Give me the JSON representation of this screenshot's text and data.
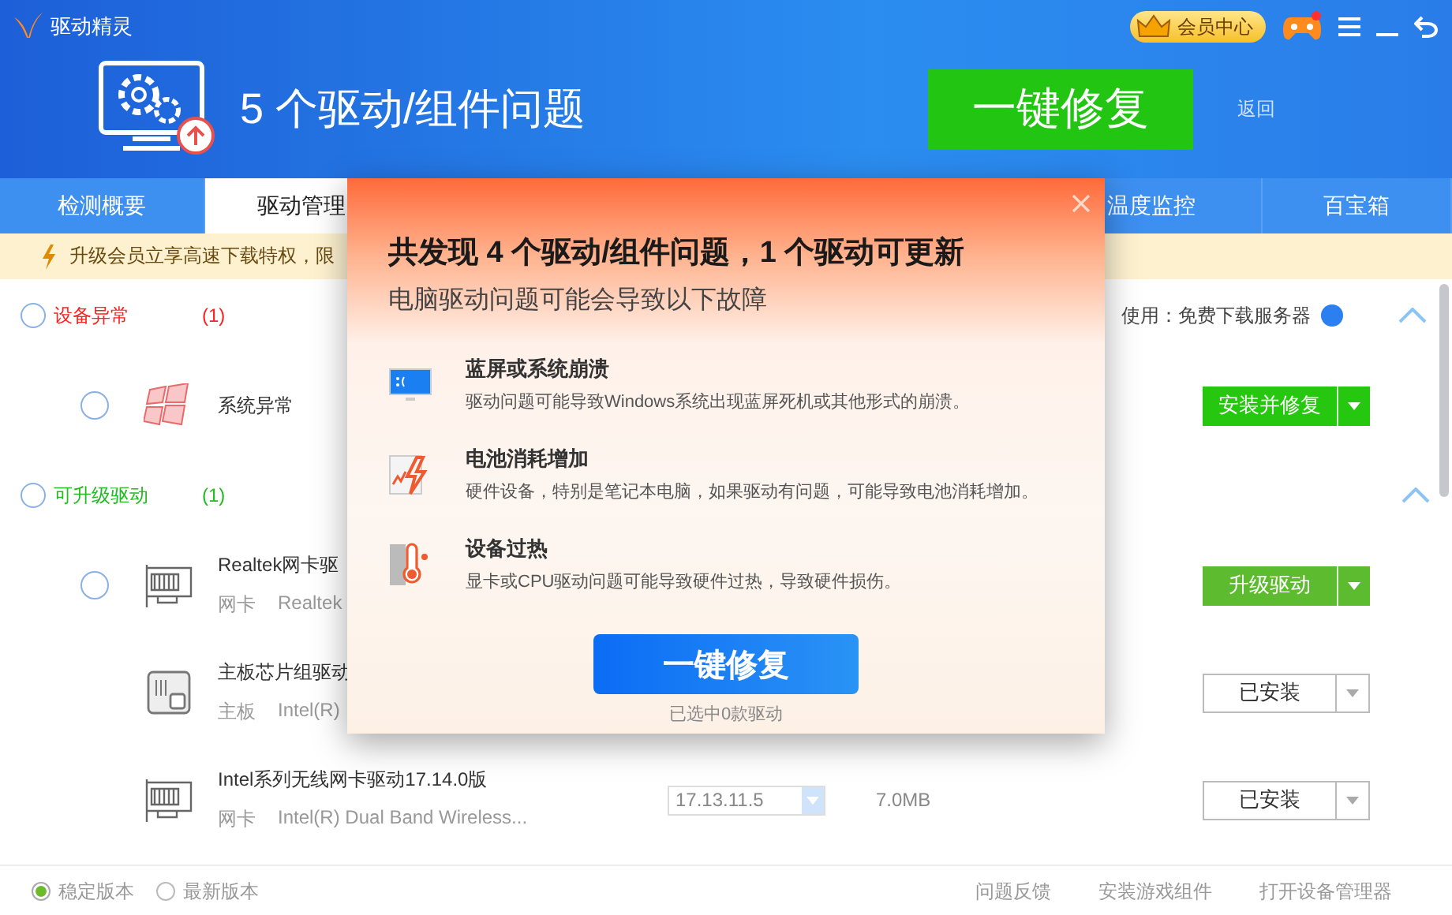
{
  "header": {
    "app_title": "驱动精灵",
    "vip_label": "会员中心",
    "issue_title": "5 个驱动/组件问题",
    "fix_button": "一键修复",
    "back_link": "返回"
  },
  "tabs": [
    {
      "label": "检测概要",
      "selected": false
    },
    {
      "label": "驱动管理",
      "selected": true
    },
    {
      "label": "温度监控",
      "selected": false
    },
    {
      "label": "百宝箱",
      "selected": false
    }
  ],
  "banner": {
    "text": "升级会员立享高速下载特权，限"
  },
  "server_note": "使用：免费下载服务器",
  "groups": [
    {
      "title": "设备异常",
      "count": "(1)",
      "color": "#ff2020",
      "checked": false,
      "expanded": true,
      "items": [
        {
          "kind": "system",
          "name": "系统异常",
          "checked": false,
          "action": {
            "label": "安装并修复",
            "kind": "primary"
          }
        }
      ]
    },
    {
      "title": "可升级驱动",
      "count": "(1)",
      "color": "#22bb22",
      "checked": false,
      "expanded": true,
      "items": [
        {
          "kind": "network",
          "name": "Realtek网卡驱",
          "category": "网卡",
          "detail": "Realtek",
          "checked": false,
          "action": {
            "label": "升级驱动",
            "kind": "upgrade"
          }
        },
        {
          "kind": "chipset",
          "name": "主板芯片组驱动",
          "category": "主板",
          "detail": "Intel(R)",
          "action": {
            "label": "已安装",
            "kind": "installed"
          }
        },
        {
          "kind": "network",
          "name": "Intel系列无线网卡驱动17.14.0版",
          "category": "网卡",
          "detail": "Intel(R) Dual Band Wireless...",
          "version": "17.13.11.5",
          "size": "7.0MB",
          "action": {
            "label": "已安装",
            "kind": "installed"
          }
        }
      ]
    }
  ],
  "footer": {
    "versions": [
      {
        "label": "稳定版本",
        "selected": true
      },
      {
        "label": "最新版本",
        "selected": false
      }
    ],
    "links": [
      "问题反馈",
      "安装游戏组件",
      "打开设备管理器"
    ]
  },
  "dialog": {
    "title": "共发现 4 个驱动/组件问题，1 个驱动可更新",
    "subtitle": "电脑驱动问题可能会导致以下故障",
    "faults": [
      {
        "kind": "crash",
        "title": "蓝屏或系统崩溃",
        "desc": "驱动问题可能导致Windows系统出现蓝屏死机或其他形式的崩溃。"
      },
      {
        "kind": "battery",
        "title": "电池消耗增加",
        "desc": "硬件设备，特别是笔记本电脑，如果驱动有问题，可能导致电池消耗增加。"
      },
      {
        "kind": "heat",
        "title": "设备过热",
        "desc": "显卡或CPU驱动问题可能导致硬件过热，导致硬件损伤。"
      }
    ],
    "fix_button": "一键修复",
    "selected_note": "已选中0款驱动"
  }
}
